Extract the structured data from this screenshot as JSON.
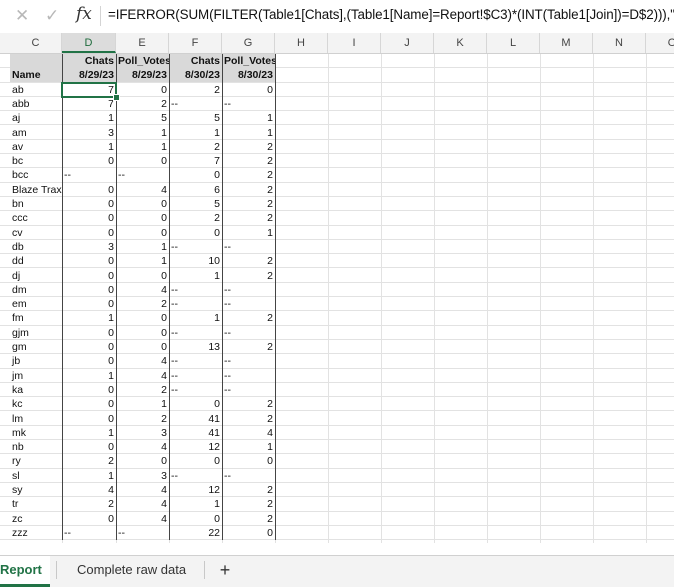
{
  "formula_bar": {
    "cancel_icon": "x-icon",
    "confirm_icon": "check-icon",
    "fx_label": "fx",
    "formula": "=IFERROR(SUM(FILTER(Table1[Chats],(Table1[Name]=Report!$C3)*(INT(Table1[Join])=D$2))),\"--\")"
  },
  "columns": [
    "C",
    "D",
    "E",
    "F",
    "G",
    "H",
    "I",
    "J",
    "K",
    "L",
    "M",
    "N",
    "O"
  ],
  "header_row1": [
    "",
    "Chats",
    "Poll_Votes",
    "Chats",
    "Poll_Votes"
  ],
  "header_row2": [
    "Name",
    "8/29/23",
    "8/29/23",
    "8/30/23",
    "8/30/23"
  ],
  "rows": [
    [
      "ab",
      "7",
      "0",
      "2",
      "0"
    ],
    [
      "abb",
      "7",
      "2",
      "--",
      "--"
    ],
    [
      "aj",
      "1",
      "5",
      "5",
      "1"
    ],
    [
      "am",
      "3",
      "1",
      "1",
      "1"
    ],
    [
      "av",
      "1",
      "1",
      "2",
      "2"
    ],
    [
      "bc",
      "0",
      "0",
      "7",
      "2"
    ],
    [
      "bcc",
      "--",
      "--",
      "0",
      "2"
    ],
    [
      "Blaze Traxler",
      "0",
      "4",
      "6",
      "2"
    ],
    [
      "bn",
      "0",
      "0",
      "5",
      "2"
    ],
    [
      "ccc",
      "0",
      "0",
      "2",
      "2"
    ],
    [
      "cv",
      "0",
      "0",
      "0",
      "1"
    ],
    [
      "db",
      "3",
      "1",
      "--",
      "--"
    ],
    [
      "dd",
      "0",
      "1",
      "10",
      "2"
    ],
    [
      "dj",
      "0",
      "0",
      "1",
      "2"
    ],
    [
      "dm",
      "0",
      "4",
      "--",
      "--"
    ],
    [
      "em",
      "0",
      "2",
      "--",
      "--"
    ],
    [
      "fm",
      "1",
      "0",
      "1",
      "2"
    ],
    [
      "gjm",
      "0",
      "0",
      "--",
      "--"
    ],
    [
      "gm",
      "0",
      "0",
      "13",
      "2"
    ],
    [
      "jb",
      "0",
      "4",
      "--",
      "--"
    ],
    [
      "jm",
      "1",
      "4",
      "--",
      "--"
    ],
    [
      "ka",
      "0",
      "2",
      "--",
      "--"
    ],
    [
      "kc",
      "0",
      "1",
      "0",
      "2"
    ],
    [
      "lm",
      "0",
      "2",
      "41",
      "2"
    ],
    [
      "mk",
      "1",
      "3",
      "41",
      "4"
    ],
    [
      "nb",
      "0",
      "4",
      "12",
      "1"
    ],
    [
      "ry",
      "2",
      "0",
      "0",
      "0"
    ],
    [
      "sl",
      "1",
      "3",
      "--",
      "--"
    ],
    [
      "sy",
      "4",
      "4",
      "12",
      "2"
    ],
    [
      "tr",
      "2",
      "4",
      "1",
      "2"
    ],
    [
      "zc",
      "0",
      "4",
      "0",
      "2"
    ],
    [
      "zzz",
      "--",
      "--",
      "22",
      "0"
    ]
  ],
  "tabs": {
    "active": "Report",
    "other": "Complete raw data",
    "add": "+"
  }
}
